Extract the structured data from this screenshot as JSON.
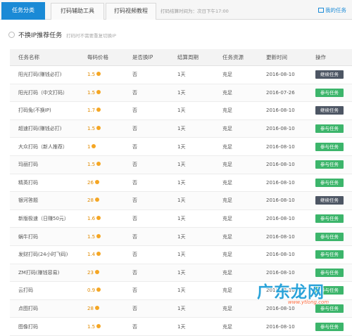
{
  "tabs": [
    {
      "label": "任务分类",
      "active": true
    },
    {
      "label": "打码辅助工具",
      "active": false
    },
    {
      "label": "打码视频教程",
      "active": false
    }
  ],
  "notice": "打码结算时间为：次日下午17:00",
  "my_task": "我的任务",
  "section": {
    "title": "不换IP推荐任务",
    "subtitle": "打码时不需要重复切换IP"
  },
  "columns": [
    "任务名称",
    "每码价格",
    "是否换IP",
    "结算周期",
    "任务资源",
    "更新时间",
    "操作"
  ],
  "rows": [
    {
      "name": "阳光打码(赚钱必打)",
      "price": "1.5",
      "ip": "否",
      "cycle": "1天",
      "res": "充足",
      "date": "2016-08-10",
      "action": "继续任务",
      "action_type": "cont"
    },
    {
      "name": "阳光打码（中文打码）",
      "price": "1.5",
      "ip": "否",
      "cycle": "1天",
      "res": "充足",
      "date": "2016-07-26",
      "action": "参与任务",
      "action_type": "go"
    },
    {
      "name": "打码兔(不换IP)",
      "price": "1.7",
      "ip": "否",
      "cycle": "1天",
      "res": "充足",
      "date": "2016-08-10",
      "action": "继续任务",
      "action_type": "cont"
    },
    {
      "name": "超速打码(赚钱必打)",
      "price": "1.5",
      "ip": "否",
      "cycle": "1天",
      "res": "充足",
      "date": "2016-08-10",
      "action": "参与任务",
      "action_type": "go"
    },
    {
      "name": "大众打码（新人推荐）",
      "price": "1",
      "ip": "否",
      "cycle": "1天",
      "res": "充足",
      "date": "2016-08-10",
      "action": "参与任务",
      "action_type": "go"
    },
    {
      "name": "玛丽打码",
      "price": "1.5",
      "ip": "否",
      "cycle": "1天",
      "res": "充足",
      "date": "2016-08-10",
      "action": "参与任务",
      "action_type": "go"
    },
    {
      "name": "精英打码",
      "price": "26",
      "ip": "否",
      "cycle": "1天",
      "res": "充足",
      "date": "2016-08-10",
      "action": "参与任务",
      "action_type": "go"
    },
    {
      "name": "银河答题",
      "price": "28",
      "ip": "否",
      "cycle": "1天",
      "res": "充足",
      "date": "2016-08-10",
      "action": "继续任务",
      "action_type": "cont"
    },
    {
      "name": "新版极速（日赚50元）",
      "price": "1.6",
      "ip": "否",
      "cycle": "1天",
      "res": "充足",
      "date": "2016-08-10",
      "action": "参与任务",
      "action_type": "go"
    },
    {
      "name": "蜗牛打码",
      "price": "1.5",
      "ip": "否",
      "cycle": "1天",
      "res": "充足",
      "date": "2016-08-10",
      "action": "参与任务",
      "action_type": "go"
    },
    {
      "name": "发财打码(24小时飞码)",
      "price": "1.4",
      "ip": "否",
      "cycle": "1天",
      "res": "充足",
      "date": "2016-08-10",
      "action": "参与任务",
      "action_type": "go"
    },
    {
      "name": "ZM打码(赚钱容易)",
      "price": "23",
      "ip": "否",
      "cycle": "1天",
      "res": "充足",
      "date": "2016-08-10",
      "action": "参与任务",
      "action_type": "go"
    },
    {
      "name": "云打码",
      "price": "0.9",
      "ip": "否",
      "cycle": "1天",
      "res": "充足",
      "date": "2016-08-10",
      "action": "参与任务",
      "action_type": "go"
    },
    {
      "name": "点图打码",
      "price": "28",
      "ip": "否",
      "cycle": "1天",
      "res": "充足",
      "date": "2016-08-10",
      "action": "参与任务",
      "action_type": "go"
    },
    {
      "name": "图像打码",
      "price": "1.5",
      "ip": "否",
      "cycle": "1天",
      "res": "充足",
      "date": "2016-08-10",
      "action": "参与任务",
      "action_type": "go"
    }
  ],
  "watermark": {
    "text": "广东龙网",
    "url": "www.ytlong.com"
  },
  "colors": {
    "accent": "#1a8ad6",
    "go_button": "#3cb56b",
    "continue_button": "#4d5664",
    "price": "#e08a00"
  },
  "icons": {
    "coin": "coin-icon",
    "my_task": "task-list-icon"
  }
}
